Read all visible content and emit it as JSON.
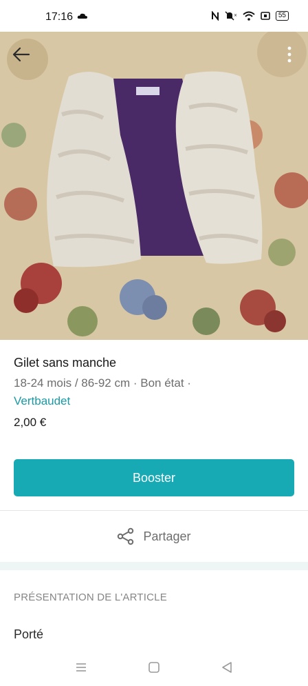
{
  "status_bar": {
    "time": "17:16",
    "battery": "55"
  },
  "item": {
    "title": "Gilet sans manche",
    "meta": "18-24 mois / 86-92 cm · Bon état ·",
    "brand": "Vertbaudet",
    "price": "2,00 €"
  },
  "actions": {
    "boost_label": "Booster",
    "share_label": "Partager"
  },
  "description": {
    "section_title": "PRÉSENTATION DE L'ARTICLE",
    "text": "Porté"
  },
  "colors": {
    "accent": "#17a9b4",
    "link": "#1a9aa4"
  },
  "icons": {
    "back": "arrow-left-icon",
    "more": "more-vertical-icon",
    "share": "share-icon",
    "nav_recent": "menu-icon",
    "nav_home": "square-icon",
    "nav_back": "triangle-back-icon"
  }
}
